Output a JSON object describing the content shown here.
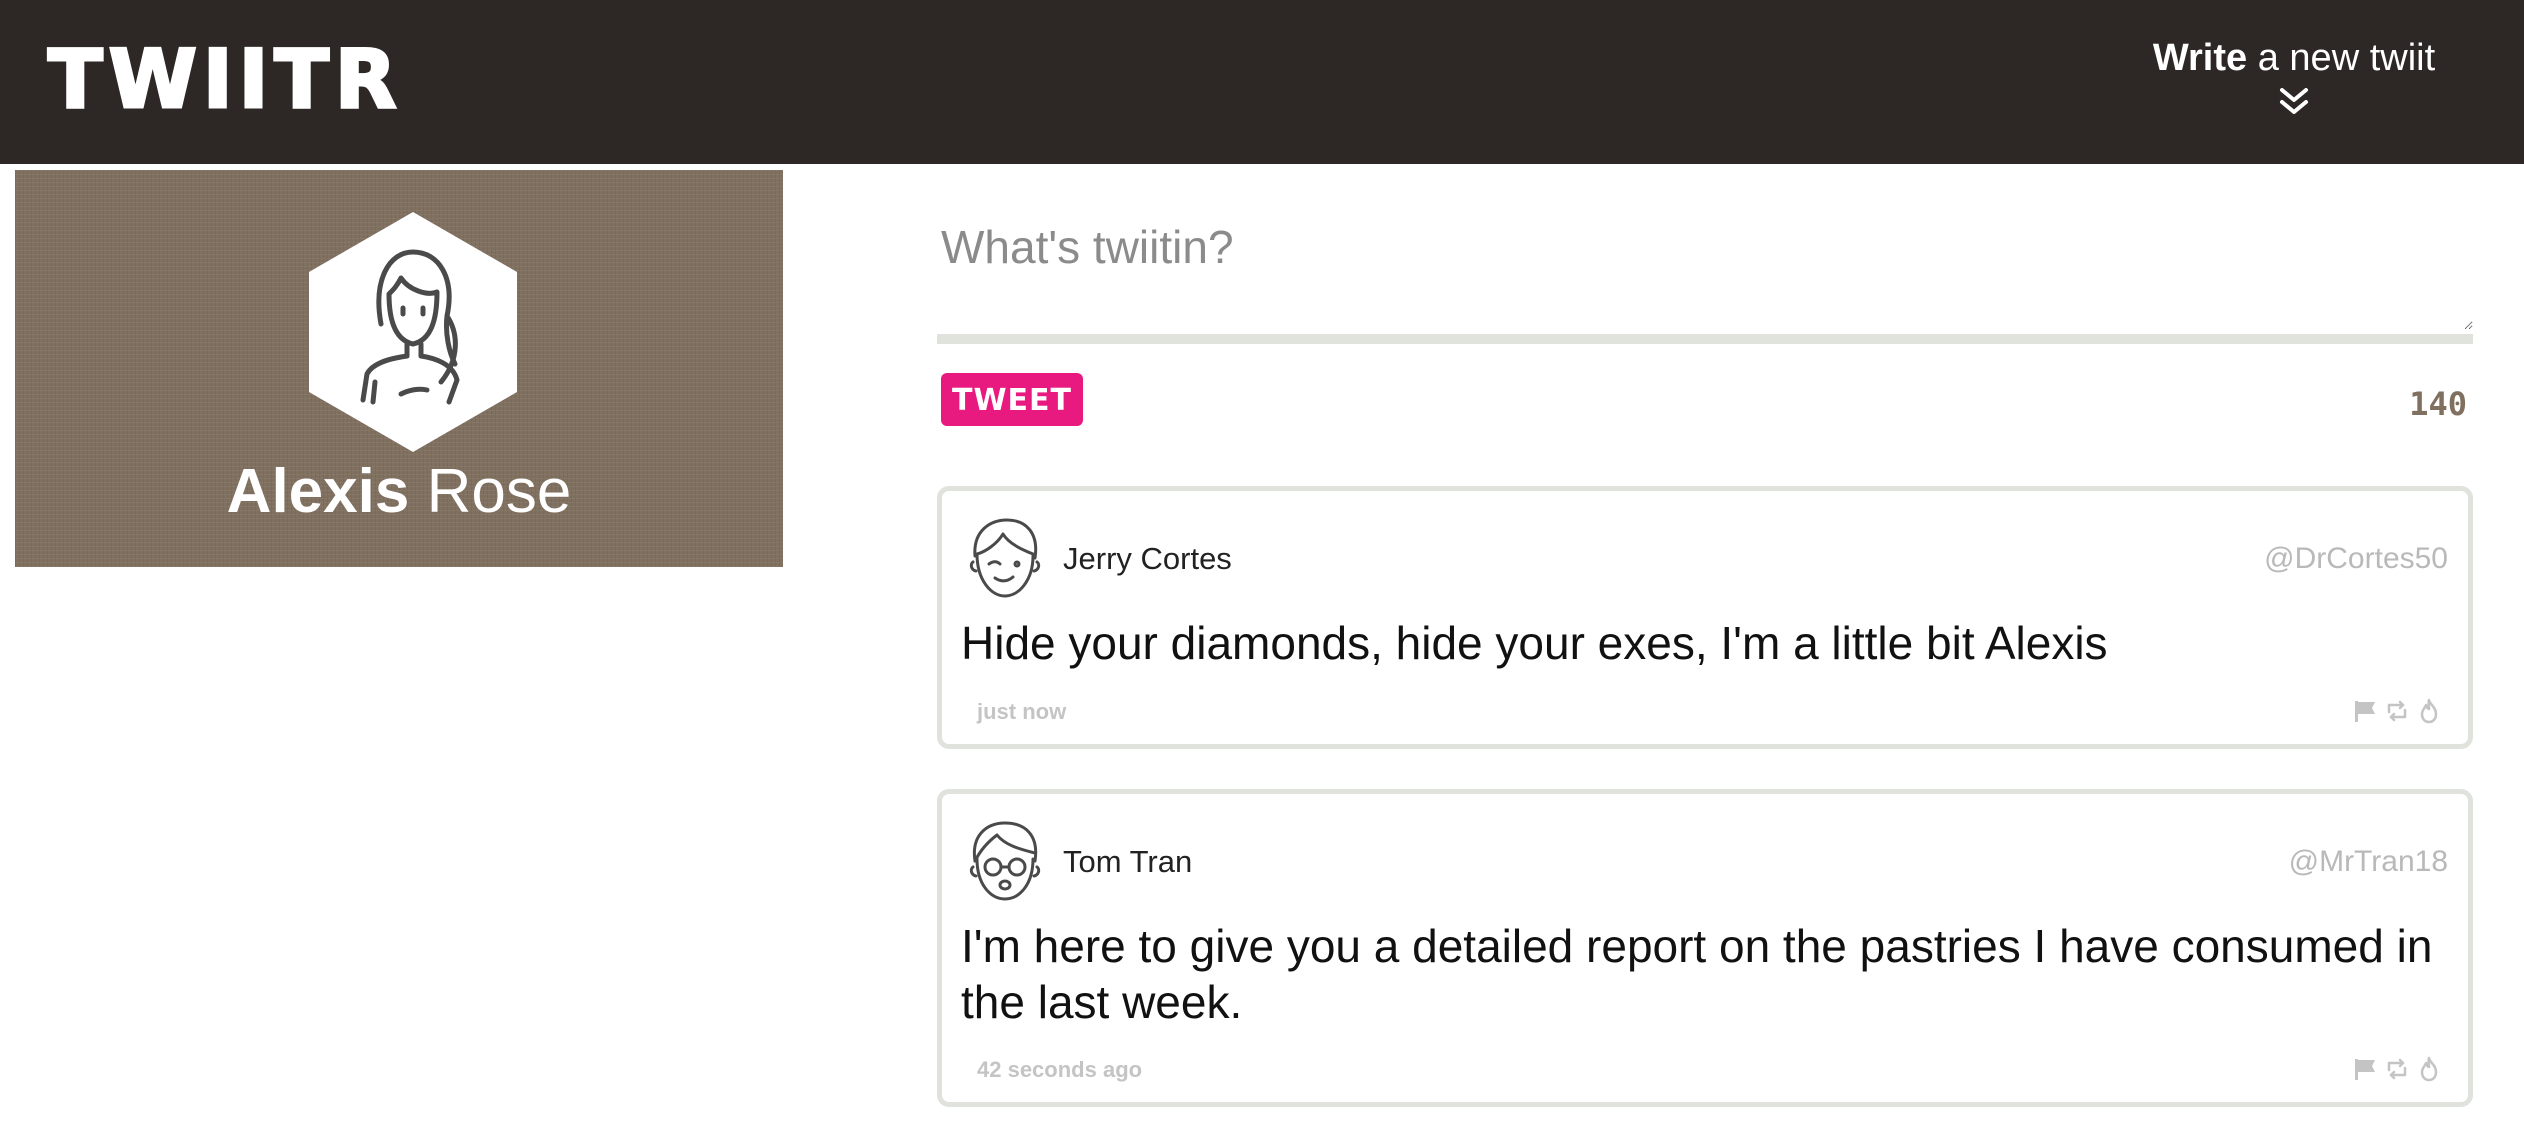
{
  "header": {
    "logo": "TWIITR",
    "compose_toggle": {
      "bold": "Write",
      "rest": " a new twiit",
      "icon": "double-chevron-down-icon"
    }
  },
  "profile": {
    "first_name": "Alexis",
    "last_name": " Rose",
    "avatar_icon": "woman-avatar-icon"
  },
  "compose": {
    "placeholder": "What's twiitin?",
    "value": "",
    "button_label": "TWEET",
    "char_count": "140"
  },
  "tweets": [
    {
      "author": "Jerry Cortes",
      "handle": "@DrCortes50",
      "text": "Hide your diamonds, hide your exes, I'm a little bit Alexis",
      "time": "just now",
      "avatar_icon": "winking-man-avatar-icon"
    },
    {
      "author": "Tom Tran",
      "handle": "@MrTran18",
      "text": "I'm here to give you a detailed report on the pastries I have consumed in the last week.",
      "time": "42 seconds ago",
      "avatar_icon": "glasses-man-avatar-icon"
    }
  ],
  "tweet_actions": [
    "flag-icon",
    "retweet-icon",
    "like-fire-icon"
  ],
  "colors": {
    "header_bg": "#2d2826",
    "profile_bg": "#807060",
    "accent": "#e8197f",
    "border": "#dfe3dc",
    "muted": "#b9b9b9"
  }
}
